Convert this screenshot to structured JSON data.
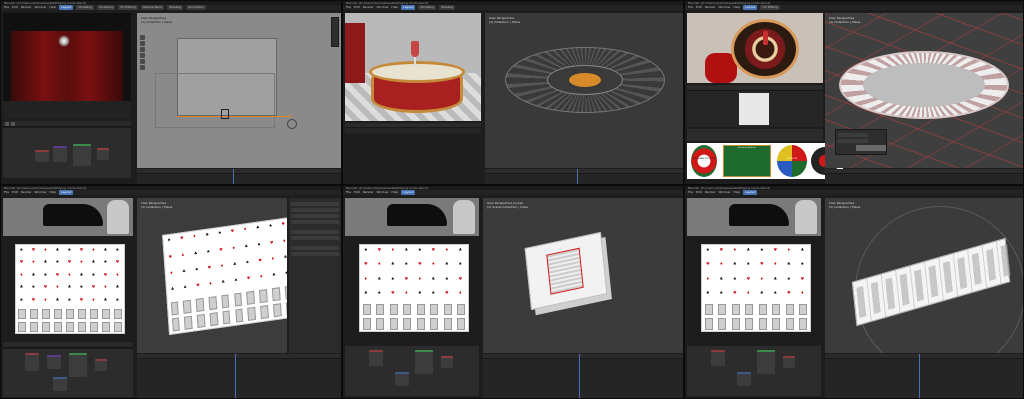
{
  "window_title": "Blender [Z:\\Casino\\Games\\Assets\\Playing Cards.blend]",
  "menus": [
    "File",
    "Edit",
    "Render",
    "Window",
    "Help"
  ],
  "workspace_tabs": [
    "Layout",
    "Modeling",
    "Sculpting",
    "UV Editing",
    "Texture Paint",
    "Shading",
    "Animation",
    "Rendering",
    "Compositing",
    "Geometry Nodes",
    "Scripting"
  ],
  "active_tab": "Layout",
  "viewport_overlay": {
    "line1": "User Perspective",
    "line2": "(1) Collection | Plane"
  },
  "viewport_overlay_alt": {
    "line1": "User Perspective (Local)",
    "line2": "(1) Scene Collection | Cube"
  },
  "timeline": {
    "labels": [
      "Playback",
      "Keying",
      "View",
      "Marker"
    ]
  },
  "node_editor": {
    "labels": [
      "Object",
      "View",
      "Select",
      "Add",
      "Node"
    ]
  },
  "roulette_cards": [
    "EUROPEAN ROULETTE",
    "European Roulette",
    "ROULETTE"
  ],
  "card_suits": {
    "spade": "♠",
    "heart": "♥",
    "diamond": "♦",
    "club": "♣"
  },
  "colors": {
    "accent": "#4772b3",
    "card_red": "#d01818",
    "felt_green": "#1f6b2e",
    "viewport": "#3d3d3d"
  }
}
